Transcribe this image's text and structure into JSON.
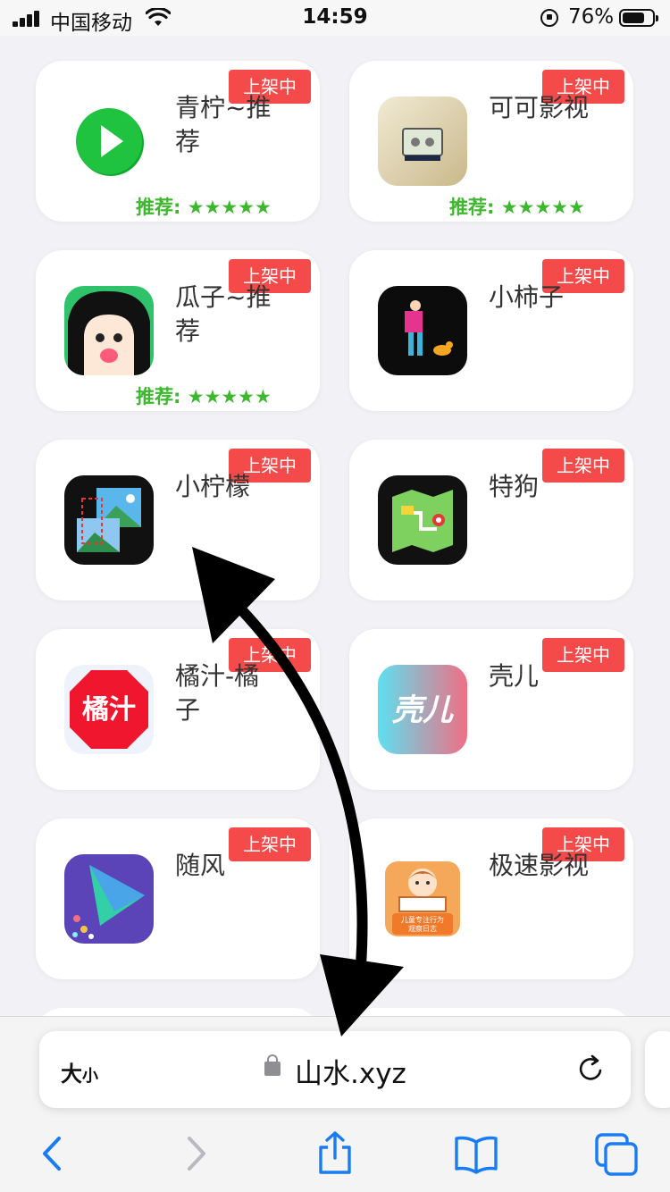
{
  "status_bar": {
    "carrier": "中国移动",
    "time": "14:59",
    "battery_percent": "76%",
    "battery_level": 0.76
  },
  "apps": [
    {
      "name": "青柠~推荐",
      "badge": "上架中",
      "rating": "推荐: ★★★★★",
      "icon": "green-play-icon"
    },
    {
      "name": "可可影视",
      "badge": "上架中",
      "rating": "推荐: ★★★★★",
      "icon": "cinema-icon"
    },
    {
      "name": "瓜子~推荐",
      "badge": "上架中",
      "rating": "推荐: ★★★★★",
      "icon": "cartoon-face-icon"
    },
    {
      "name": "小柿子",
      "badge": "上架中",
      "rating": "",
      "icon": "dancer-dog-icon"
    },
    {
      "name": "小柠檬",
      "badge": "上架中",
      "rating": "",
      "icon": "image-crop-icon"
    },
    {
      "name": "特狗",
      "badge": "上架中",
      "rating": "",
      "icon": "map-icon"
    },
    {
      "name": "橘汁-橘子",
      "badge": "上架中",
      "rating": "",
      "icon": "orange-juice-icon",
      "icon_text": "橘汁"
    },
    {
      "name": "壳儿",
      "badge": "上架中",
      "rating": "",
      "icon": "ker-icon",
      "icon_text": "壳儿"
    },
    {
      "name": "随风",
      "badge": "上架中",
      "rating": "",
      "icon": "purple-play-icon"
    },
    {
      "name": "极速影视",
      "badge": "上架中",
      "rating": "",
      "icon": "reading-kid-icon",
      "icon_text": "儿童专注行为 观察日志"
    }
  ],
  "address_bar": {
    "font_size_label": "大",
    "font_size_small": "小",
    "url": "山水.xyz"
  }
}
